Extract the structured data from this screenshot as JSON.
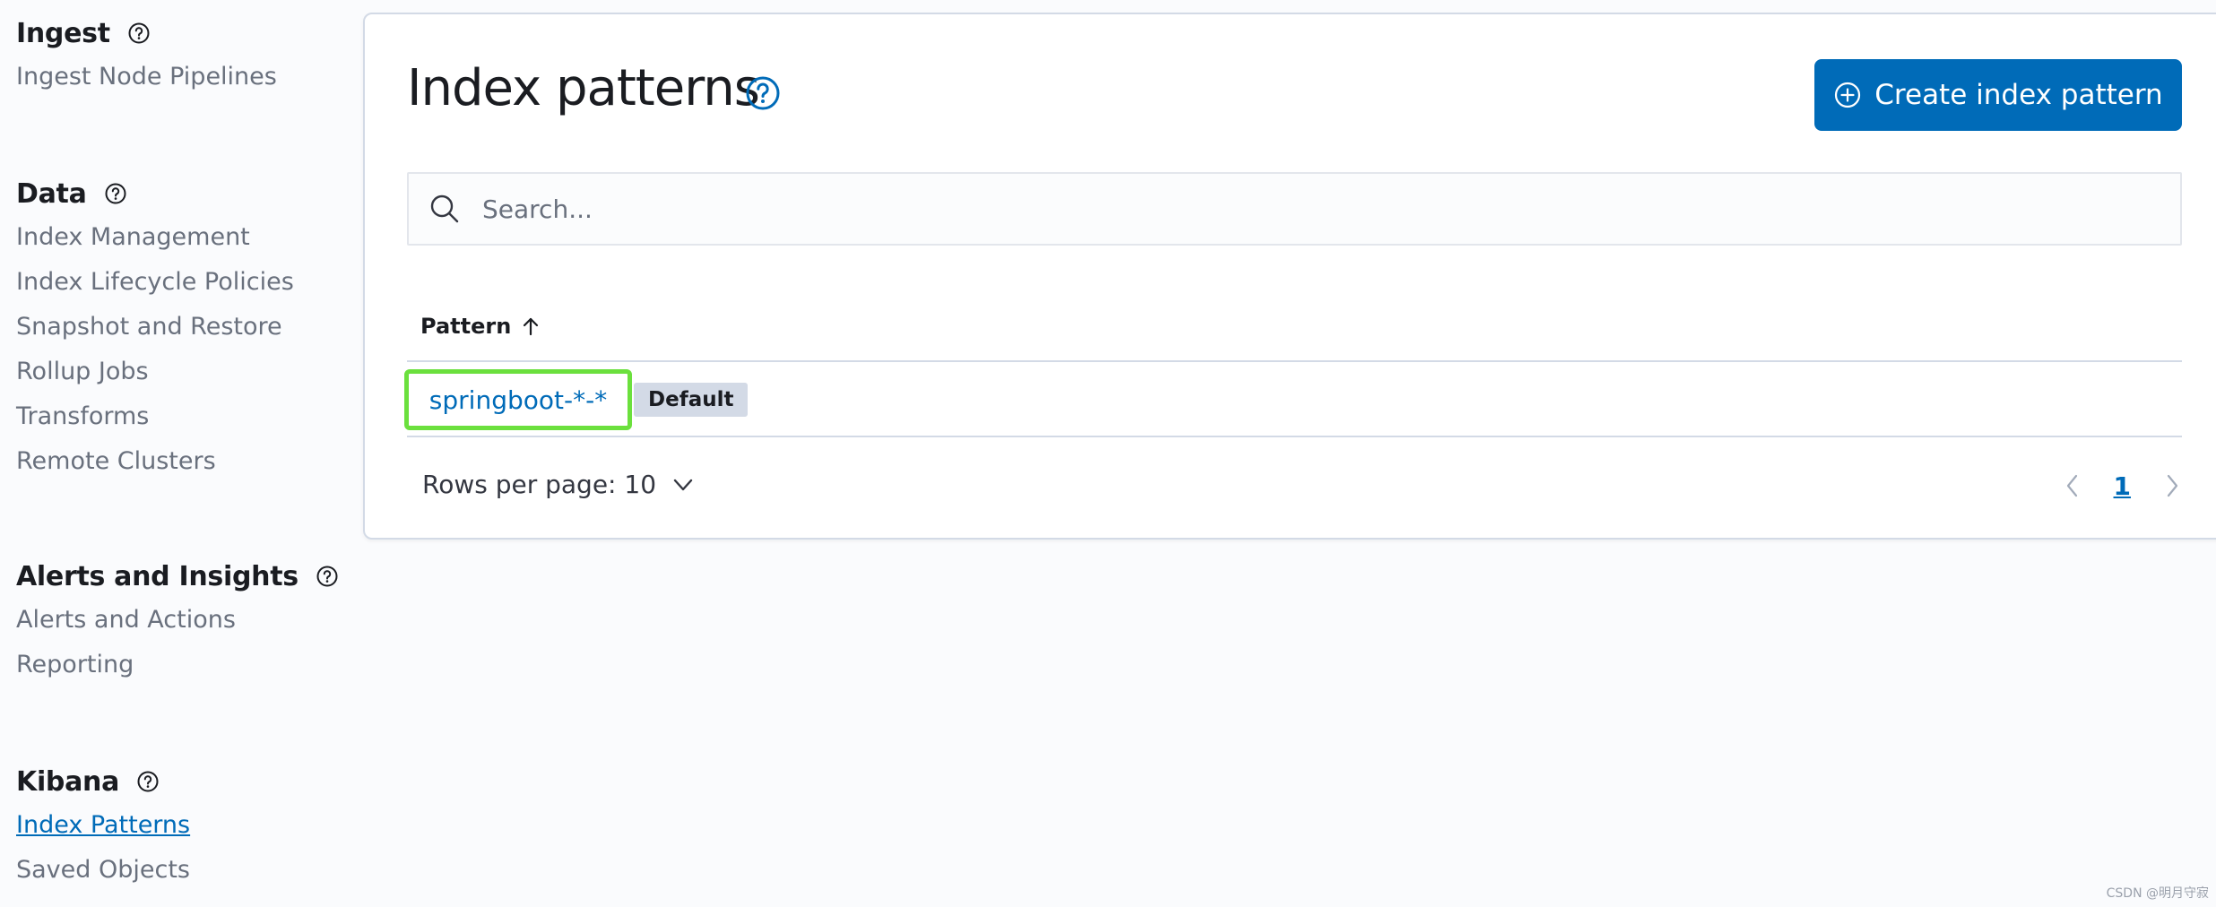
{
  "sidebar": {
    "groups": [
      {
        "title": "Ingest",
        "items": [
          "Ingest Node Pipelines"
        ]
      },
      {
        "title": "Data",
        "items": [
          "Index Management",
          "Index Lifecycle Policies",
          "Snapshot and Restore",
          "Rollup Jobs",
          "Transforms",
          "Remote Clusters"
        ]
      },
      {
        "title": "Alerts and Insights",
        "items": [
          "Alerts and Actions",
          "Reporting"
        ]
      },
      {
        "title": "Kibana",
        "items": [
          "Index Patterns",
          "Saved Objects"
        ]
      }
    ],
    "active_item": "Index Patterns"
  },
  "main": {
    "title": "Index patterns",
    "create_button_label": "Create index pattern",
    "search_placeholder": "Search...",
    "table": {
      "column_header": "Pattern",
      "sort_direction": "ascending",
      "rows": [
        {
          "pattern": "springboot-*-*",
          "badge": "Default"
        }
      ]
    },
    "rows_per_page_label": "Rows per page: 10",
    "pagination": {
      "current_page": "1"
    }
  },
  "watermark": "CSDN @明月守寂",
  "colors": {
    "accent": "#006bb8",
    "highlight_border": "#6be03d",
    "badge_bg": "#d3dae6"
  },
  "icons": {
    "help": "question-circle-icon",
    "create": "plus-circle-icon",
    "search": "search-icon",
    "sort": "arrow-up-icon",
    "rows_dropdown": "chevron-down-icon",
    "prev": "chevron-left-icon",
    "next": "chevron-right-icon"
  }
}
